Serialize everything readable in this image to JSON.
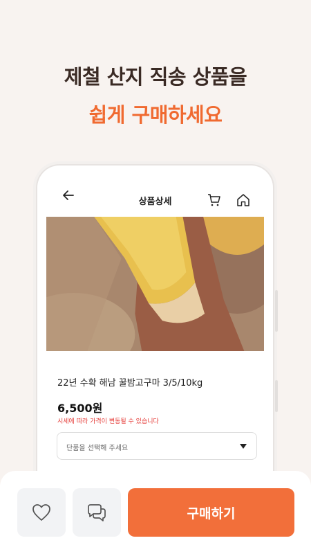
{
  "promo": {
    "line1": "제철 산지 직송 상품을",
    "line2": "쉽게 구매하세요"
  },
  "colors": {
    "accent": "#f26f3a",
    "headline": "#3a2a24",
    "notice": "#e53935",
    "background": "#f8f3f0"
  },
  "appbar": {
    "title": "상품상세",
    "icons": [
      "back-arrow-icon",
      "cart-icon",
      "home-icon"
    ]
  },
  "product": {
    "name": "22년 수확 해남 꿀밤고구마 3/5/10kg",
    "price": "6,500원",
    "notice": "시세에 따라 가격이 변동될 수 있습니다",
    "option_placeholder": "단품을 선택해 주세요"
  },
  "bottom_bar": {
    "like_icon": "heart-icon",
    "chat_icon": "chat-icon",
    "buy_label": "구매하기"
  }
}
